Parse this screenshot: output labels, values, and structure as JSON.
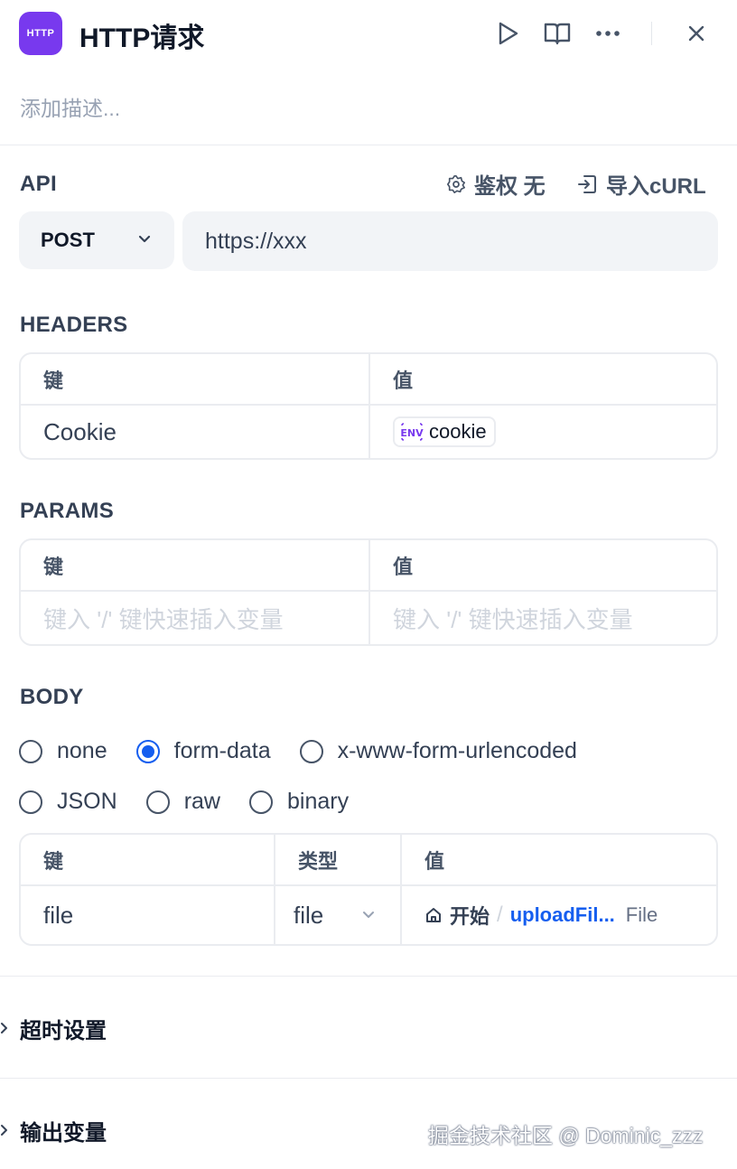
{
  "header": {
    "node_badge": "HTTP",
    "title": "HTTP请求",
    "description_placeholder": "添加描述..."
  },
  "api": {
    "section_label": "API",
    "auth_label": "鉴权 无",
    "import_label": "导入cURL",
    "method": "POST",
    "url": "https://xxx"
  },
  "headers": {
    "section_label": "HEADERS",
    "key_header": "键",
    "value_header": "值",
    "rows": [
      {
        "key": "Cookie",
        "env_value": "cookie"
      }
    ]
  },
  "params": {
    "section_label": "PARAMS",
    "key_header": "键",
    "value_header": "值",
    "key_placeholder": "键入 '/' 键快速插入变量",
    "value_placeholder": "键入 '/' 键快速插入变量"
  },
  "body": {
    "section_label": "BODY",
    "options": [
      "none",
      "form-data",
      "x-www-form-urlencoded",
      "JSON",
      "raw",
      "binary"
    ],
    "selected": "form-data",
    "key_header": "键",
    "type_header": "类型",
    "value_header": "值",
    "row": {
      "key": "file",
      "type": "file",
      "node_name": "开始",
      "separator": "/",
      "var_name": "uploadFil...",
      "var_type": "File"
    }
  },
  "collapsibles": {
    "timeout": "超时设置",
    "output": "输出变量"
  },
  "watermark": "掘金技术社区 @ Dominic_zzz",
  "colors": {
    "accent": "#155eef",
    "node_icon_bg": "#7839ee"
  },
  "icons": [
    "play-icon",
    "book-icon",
    "more-icon",
    "close-icon",
    "gear-icon",
    "import-icon",
    "chevron-down-icon",
    "env-icon",
    "home-icon",
    "chevron-right-icon"
  ]
}
